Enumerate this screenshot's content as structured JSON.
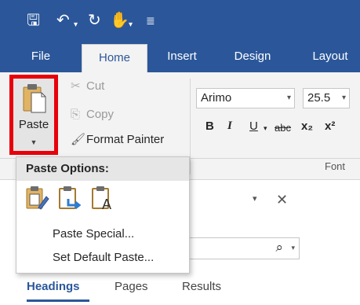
{
  "quick_access": {
    "save_icon": "save-icon",
    "undo_icon": "undo-icon",
    "redo_icon": "redo-icon",
    "touch_icon": "touch-mode-icon",
    "customize_icon": "customize-icon"
  },
  "tabs": [
    {
      "label": "File"
    },
    {
      "label": "Home"
    },
    {
      "label": "Insert"
    },
    {
      "label": "Design"
    },
    {
      "label": "Layout"
    }
  ],
  "clipboard": {
    "paste_label": "Paste",
    "cut_label": "Cut",
    "copy_label": "Copy",
    "format_painter_label": "Format Painter"
  },
  "font": {
    "name": "Arimo",
    "size": "25.5",
    "bold": "B",
    "italic": "I",
    "underline": "U",
    "strike": "abc",
    "subscript": "x₂",
    "superscript": "x²",
    "group_label": "Font"
  },
  "paste_menu": {
    "header": "Paste Options:",
    "items": [
      {
        "label": "Paste Special..."
      },
      {
        "label": "Set Default Paste..."
      }
    ]
  },
  "nav_pane": {
    "tabs": [
      {
        "label": "Headings"
      },
      {
        "label": "Pages"
      },
      {
        "label": "Results"
      }
    ]
  },
  "colors": {
    "accent": "#2b579a",
    "highlight": "#e8000b"
  }
}
